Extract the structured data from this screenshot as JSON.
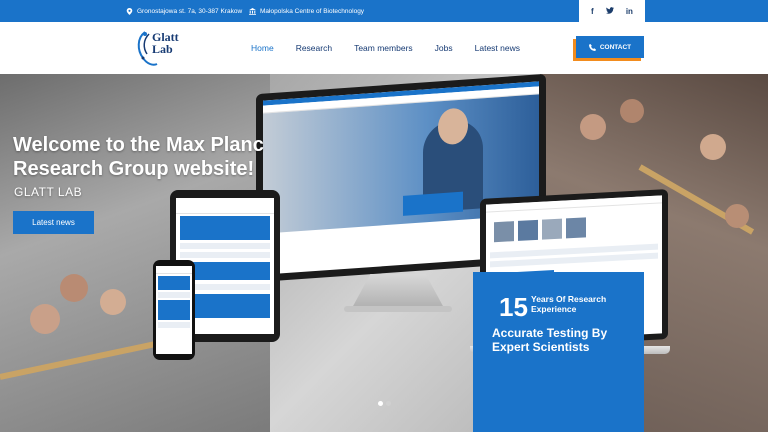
{
  "topbar": {
    "address": "Gronostajowa st. 7a, 30-387 Krakow",
    "centre": "Małopolska Centre of Biotechnology",
    "social": [
      {
        "icon": "facebook-icon",
        "label": "f"
      },
      {
        "icon": "twitter-icon",
        "label": "🐦"
      },
      {
        "icon": "linkedin-icon",
        "label": "in"
      }
    ]
  },
  "header": {
    "logo_line1": "Glatt",
    "logo_line2": "Lab",
    "nav": [
      "Home",
      "Research",
      "Team members",
      "Jobs",
      "Latest news"
    ],
    "active_nav": "Home",
    "contact_label": "CONTACT"
  },
  "hero": {
    "title_line1": "Welcome to the Max Planc",
    "title_line2": "Research Group website!",
    "subtitle": "GLATT LAB",
    "button_label": "Latest news"
  },
  "stats": {
    "number": "15",
    "number_label": "Years Of Research Experience",
    "tagline": "Accurate Testing By Expert Scientists"
  },
  "slider": {
    "dots": 2,
    "active_index": 0
  },
  "colors": {
    "primary": "#1a73c9",
    "dark_blue": "#163a73",
    "accent": "#f28c1e",
    "white": "#ffffff"
  }
}
